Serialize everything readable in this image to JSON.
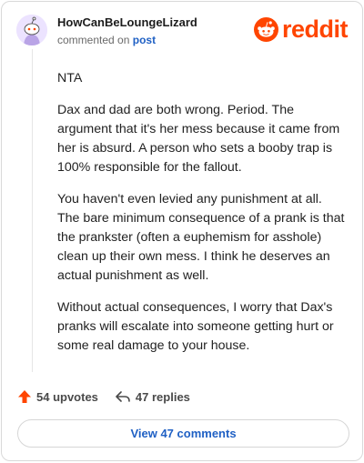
{
  "comment": {
    "username": "HowCanBeLoungeLizard",
    "meta_prefix": "commented on",
    "meta_link": "post",
    "paragraphs": [
      "NTA",
      "Dax and dad are both wrong. Period. The argument that it's her mess because it came from her is absurd. A person who sets a booby trap is 100% responsible for the fallout.",
      "You haven't even levied any punishment at all. The bare minimum consequence of a prank is that the prankster (often a euphemism for asshole) clean up their own mess. I think he deserves an actual punishment as well.",
      "Without actual consequences, I worry that Dax's pranks will escalate into someone getting hurt or some real damage to your house."
    ]
  },
  "brand": {
    "logo_text": "reddit",
    "color": "#ff4500"
  },
  "actions": {
    "upvotes": "54 upvotes",
    "replies": "47 replies",
    "upvote_icon": "upvote-arrow-icon",
    "reply_icon": "reply-arrow-icon"
  },
  "view_button": "View 47 comments",
  "colors": {
    "accent": "#ff4500",
    "link": "#1f60c4",
    "avatar_bg": "#ece3ff"
  }
}
